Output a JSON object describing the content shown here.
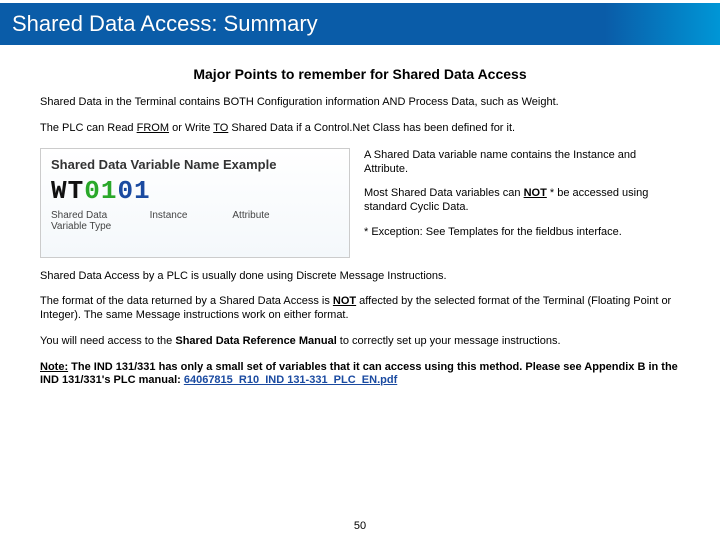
{
  "title": "Shared Data Access: Summary",
  "subheading": "Major Points to remember for Shared Data Access",
  "p1": "Shared Data in the Terminal contains BOTH Configuration information AND Process Data, such as Weight.",
  "p2a": "The PLC can Read ",
  "p2_from": "FROM",
  "p2b": " or Write ",
  "p2_to": "TO",
  "p2c": " Shared Data if a Control.Net Class has been defined for it.",
  "fig": {
    "title": "Shared Data Variable Name Example",
    "wt": "WT",
    "inst": "01",
    "attr": "01",
    "lab_type": "Shared Data Variable Type",
    "lab_inst": "Instance",
    "lab_attr": "Attribute"
  },
  "side": {
    "s1": "A Shared Data variable name contains the Instance and Attribute.",
    "s2a": "Most Shared Data variables can ",
    "s2_not": "NOT",
    "s2b": " * be accessed using standard Cyclic Data.",
    "s3": "* Exception:  See Templates for the fieldbus interface."
  },
  "p3": "Shared Data Access by a PLC is usually done using Discrete Message Instructions.",
  "p4a": "The format of the data returned by a Shared Data Access is ",
  "p4_not": "NOT",
  "p4b": " affected by the selected format of the Terminal (Floating Point or Integer).  The same Message instructions work on either format.",
  "p5a": "You will need access to the ",
  "p5_manual": "Shared Data Reference Manual",
  "p5b": " to correctly set up your message instructions.",
  "note_label": "Note:",
  "note_body": "  The IND 131/331 has only a small set of variables that it can access using this method.  Please see Appendix B in the IND 131/331's PLC manual: ",
  "note_link": "64067815_R10_IND 131-331_PLC_EN.pdf",
  "page_number": "50"
}
